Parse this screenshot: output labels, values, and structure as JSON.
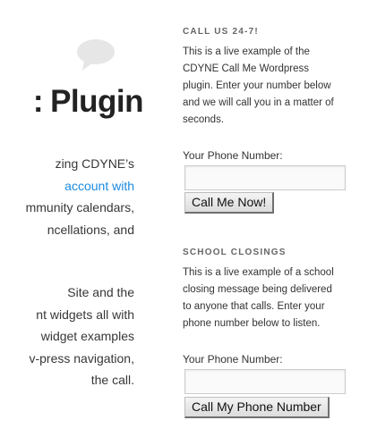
{
  "main": {
    "title": "Plugin",
    "title_fragment": ":",
    "paragraph1": [
      {
        "text": "zing CDYNE’s",
        "link": false
      },
      {
        "text": "account with",
        "link": true
      },
      {
        "text": "mmunity calendars,",
        "link": false
      },
      {
        "text": "ncellations, and",
        "link": false
      }
    ],
    "paragraph2": [
      {
        "text": "Site and the",
        "link": false
      },
      {
        "text": "nt widgets all with",
        "link": false
      },
      {
        "text": "widget examples",
        "link": false
      },
      {
        "text": "v-press navigation,",
        "link": false
      },
      {
        "text": "the call.",
        "link": false
      }
    ],
    "comment_icon": "speech-bubble-icon"
  },
  "sidebar": {
    "call_widget": {
      "title": "CALL US 24-7!",
      "description": [
        "This is a live example of the",
        "CDYNE Call Me Wordpress",
        "plugin. Enter your number below",
        "and we will call you in a matter of",
        "seconds."
      ],
      "phone_label": "Your Phone Number:",
      "phone_value": "",
      "button_label": "Call Me Now!"
    },
    "school_widget": {
      "title": "SCHOOL CLOSINGS",
      "description": [
        "This is a live example of a school",
        "closing message being delivered",
        "to anyone that calls. Enter your",
        "phone number below to listen."
      ],
      "phone_label": "Your Phone Number:",
      "phone_value": "",
      "button_label": "Call My Phone Number"
    }
  },
  "colors": {
    "link": "#1b8be0",
    "title": "#222222",
    "bubble": "#e8e8e8"
  }
}
